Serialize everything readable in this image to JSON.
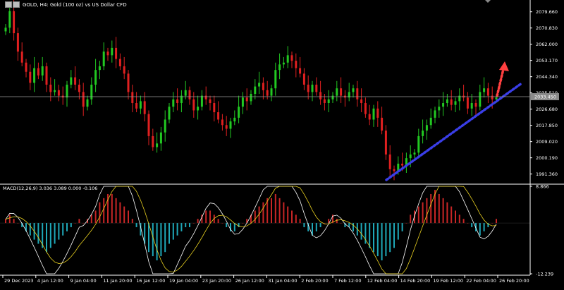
{
  "header": {
    "title": "GOLD, H4:  Gold (100 oz) vs US Dollar CFD"
  },
  "colors": {
    "background": "#000000",
    "bull": "#22c922",
    "bear": "#e02020",
    "grid_text": "#ffffff",
    "axis": "#ffffff",
    "current_price_label": "#8a8a8a",
    "macd_hist_pos": "#c82626",
    "macd_hist_neg": "#1fa8b8",
    "macd_line": "#ffffff",
    "signal_line": "#e8d020",
    "trendline": "#3a3ee8",
    "arrow": "#ff4040"
  },
  "price_axis": {
    "ticks": [
      "2079.660",
      "2070.830",
      "2062.000",
      "2053.170",
      "2044.340",
      "2035.510",
      "2026.680",
      "2017.850",
      "2009.020",
      "2000.190",
      "1991.360"
    ],
    "current_price": "2033.450"
  },
  "macd": {
    "label": "MACD(12,26,9) 3.036 3.089 0.000 -0.106",
    "ticks": [
      "8.866",
      "-12.239"
    ]
  },
  "time_axis": {
    "labels": [
      "29 Dec 2023",
      "4 Jan 12:00",
      "9 Jan 04:00",
      "11 Jan 20:00",
      "16 Jan 12:00",
      "19 Jan 04:00",
      "23 Jan 20:00",
      "26 Jan 12:00",
      "31 Jan 04:00",
      "2 Feb 20:00",
      "7 Feb 12:00",
      "12 Feb 04:00",
      "14 Feb 20:00",
      "19 Feb 12:00",
      "22 Feb 04:00",
      "26 Feb 20:00"
    ]
  },
  "chart_data": {
    "type": "candlestick",
    "symbol": "GOLD",
    "timeframe": "H4",
    "ylim": [
      1987,
      2083
    ],
    "price_path": [
      2071,
      2080,
      2068,
      2058,
      2052,
      2047,
      2041,
      2049,
      2045,
      2050,
      2040,
      2036,
      2037,
      2034,
      2033,
      2040,
      2044,
      2040,
      2036,
      2028,
      2032,
      2040,
      2048,
      2050,
      2058,
      2056,
      2060,
      2054,
      2050,
      2046,
      2036,
      2030,
      2027,
      2031,
      2024,
      2012,
      2006,
      2008,
      2014,
      2021,
      2028,
      2032,
      2030,
      2034,
      2037,
      2032,
      2026,
      2028,
      2034,
      2032,
      2030,
      2025,
      2021,
      2018,
      2016,
      2020,
      2022,
      2028,
      2033,
      2031,
      2035,
      2039,
      2041,
      2037,
      2034,
      2038,
      2048,
      2051,
      2052,
      2056,
      2053,
      2049,
      2046,
      2040,
      2036,
      2040,
      2036,
      2032,
      2030,
      2032,
      2034,
      2038,
      2034,
      2033,
      2036,
      2038,
      2032,
      2030,
      2024,
      2021,
      2027,
      2022,
      2015,
      2002,
      1994,
      1993,
      1997,
      1996,
      2000,
      2002,
      2003,
      2012,
      2015,
      2018,
      2022,
      2026,
      2028,
      2030,
      2032,
      2029,
      2031,
      2034,
      2033,
      2027,
      2030,
      2028,
      2036,
      2038,
      2034,
      2032,
      2033
    ],
    "macd_hist": [
      1,
      2,
      1,
      0,
      -1,
      -2,
      -3,
      -4,
      -5,
      -6,
      -7,
      -6,
      -5,
      -4,
      -3,
      -2,
      -1,
      0,
      1,
      0,
      1,
      2,
      3,
      5,
      6,
      7,
      7,
      6,
      5,
      4,
      3,
      1,
      -1,
      -3,
      -5,
      -7,
      -8,
      -9,
      -8,
      -7,
      -5,
      -4,
      -3,
      -2,
      -1,
      -1,
      0,
      1,
      2,
      3,
      3,
      2,
      1,
      0,
      -1,
      -2,
      -2,
      -1,
      0,
      1,
      2,
      3,
      4,
      5,
      6,
      6,
      7,
      6,
      5,
      4,
      3,
      2,
      1,
      -1,
      -2,
      -3,
      -2,
      -1,
      0,
      1,
      2,
      1,
      0,
      -1,
      -1,
      -2,
      -3,
      -4,
      -5,
      -6,
      -7,
      -8,
      -9,
      -8,
      -7,
      -6,
      -4,
      -2,
      0,
      2,
      3,
      4,
      5,
      6,
      7,
      8,
      7,
      6,
      5,
      4,
      3,
      2,
      1,
      0,
      -1,
      -2,
      -3,
      -2,
      -1,
      0,
      1
    ],
    "macd_ylim": [
      -12.239,
      8.866
    ]
  },
  "annotations": {
    "trendline": "dotted blue support line",
    "arrow": "dotted red upward arrow"
  }
}
